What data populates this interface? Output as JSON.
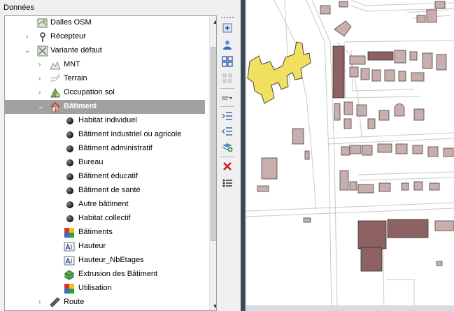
{
  "panel": {
    "title": "Données"
  },
  "tree": {
    "dalles_osm": "Dalles OSM",
    "recepteur": "Récepteur",
    "variante": "Variante défaut",
    "mnt": "MNT",
    "terrain": "Terrain",
    "occupation": "Occupation sol",
    "batiment": "Bâtiment",
    "children": [
      "Habitat individuel",
      "Bâtiment industriel ou agricole",
      "Bâtiment administratif",
      "Bureau",
      "Bâtiment éducatif",
      "Bâtiment de santé",
      "Autre bâtiment",
      "Habitat collectif"
    ],
    "batiments": "Bâtiments",
    "hauteur": "Hauteur",
    "hauteur_nbetages": "Hauteur_NbEtages",
    "extrusion": "Extrusion des Bâtiment",
    "utilisation": "Utilisation",
    "route": "Route"
  },
  "colors": {
    "selected_bg": "#a0a0a0",
    "building_fill": "#c9aeae",
    "building_dark": "#8e6262",
    "highlight_fill": "#f0e060"
  }
}
